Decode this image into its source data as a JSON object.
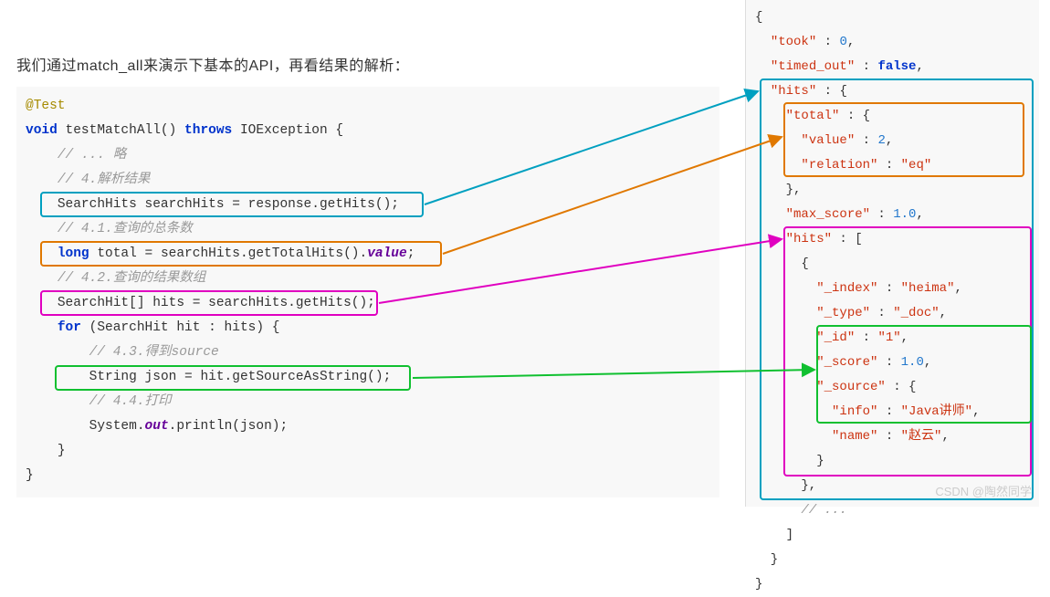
{
  "intro": "我们通过match_all来演示下基本的API，再看结果的解析：",
  "left": {
    "anno": "@Test",
    "void": "void",
    "method": " testMatchAll() ",
    "throws": "throws",
    "exception": " IOException {",
    "c1": "// ... 略",
    "c2": "// 4.解析结果",
    "l1": "SearchHits searchHits = response.getHits();",
    "c3": "// 4.1.查询的总条数",
    "kw_long": "long",
    "l2a": " total = searchHits.getTotalHits().",
    "l2b": "value",
    "l2c": ";",
    "c4": "// 4.2.查询的结果数组",
    "l3": "SearchHit[] hits = searchHits.getHits();",
    "for": "for",
    "l4": " (SearchHit hit : hits) {",
    "c5": "// 4.3.得到source",
    "l5": "String json = hit.getSourceAsString();",
    "c6": "// 4.4.打印",
    "l6a": "System.",
    "l6b": "out",
    "l6c": ".println(json);",
    "rb1": "}",
    "rb2": "}"
  },
  "right": {
    "took_k": "\"took\"",
    "took_v": "0",
    "timed_k": "\"timed_out\"",
    "timed_v": "false",
    "hits_k": "\"hits\"",
    "total_k": "\"total\"",
    "value_k": "\"value\"",
    "value_v": "2",
    "relation_k": "\"relation\"",
    "relation_v": "\"eq\"",
    "max_k": "\"max_score\"",
    "max_v": "1.0",
    "hits2_k": "\"hits\"",
    "index_k": "\"_index\"",
    "index_v": "\"heima\"",
    "type_k": "\"_type\"",
    "type_v": "\"_doc\"",
    "id_k": "\"_id\"",
    "id_v": "\"1\"",
    "score_k": "\"_score\"",
    "score_v": "1.0",
    "source_k": "\"_source\"",
    "info_k": "\"info\"",
    "info_v": "\"Java讲师\"",
    "name_k": "\"name\"",
    "name_v": "\"赵云\"",
    "ellipsis": "// ..."
  },
  "watermark": "CSDN @陶然同学"
}
